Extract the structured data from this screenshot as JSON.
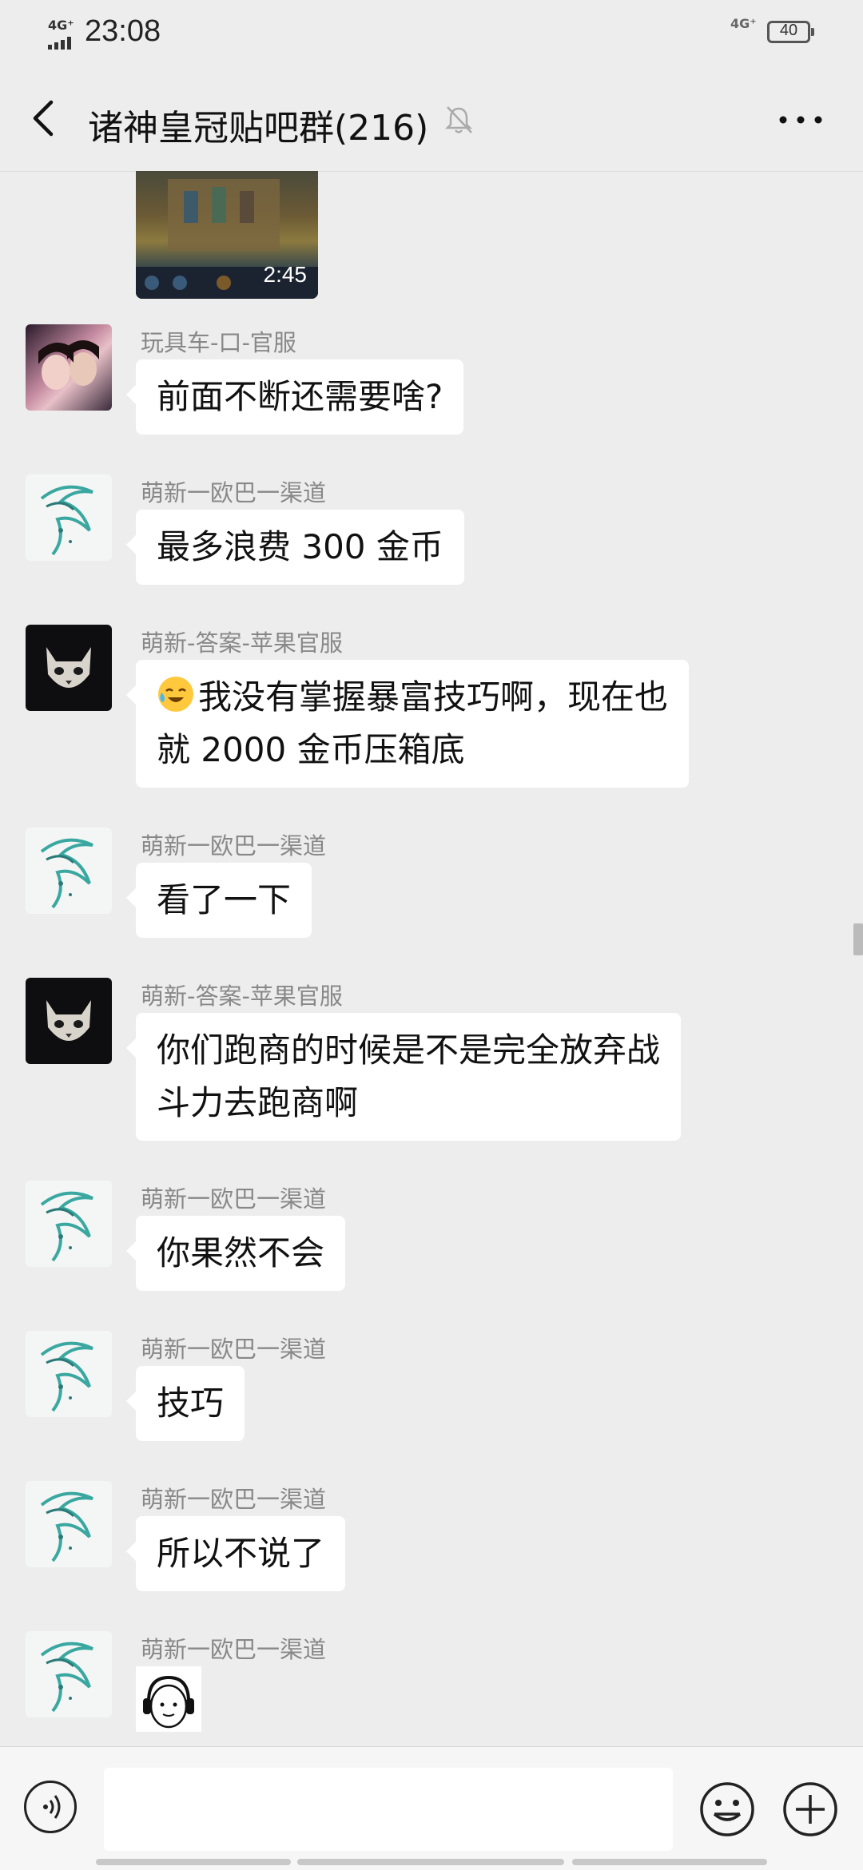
{
  "status_bar": {
    "network_left": "4G⁺",
    "time": "23:08",
    "network_right": "4G⁺",
    "battery": "40"
  },
  "header": {
    "title": "诸神皇冠贴吧群(216)",
    "back_icon": "chevron-left-icon",
    "mute_icon": "bell-muted-icon",
    "more_icon": "more-dots-icon"
  },
  "video_message": {
    "duration": "2:45"
  },
  "messages": [
    {
      "sender": "玩具车-口-官服",
      "text": "前面不断还需要啥?"
    },
    {
      "sender": "萌新一欧巴一渠道",
      "text": "最多浪费 300 金币"
    },
    {
      "sender": "萌新-答案-苹果官服",
      "lines": [
        "我没有掌握暴富技巧啊，现在也",
        "就 2000 金币压箱底"
      ],
      "emoji": "crying-laughing-face"
    },
    {
      "sender": "萌新一欧巴一渠道",
      "text": "看了一下"
    },
    {
      "sender": "萌新-答案-苹果官服",
      "lines": [
        "你们跑商的时候是不是完全放弃战",
        "斗力去跑商啊"
      ]
    },
    {
      "sender": "萌新一欧巴一渠道",
      "text": "你果然不会"
    },
    {
      "sender": "萌新一欧巴一渠道",
      "text": "技巧"
    },
    {
      "sender": "萌新一欧巴一渠道",
      "text": "所以不说了"
    },
    {
      "sender": "萌新一欧巴一渠道",
      "sticker": "headphones-cartoon-sticker"
    }
  ],
  "composer": {
    "input_value": "",
    "voice_icon": "voice-icon",
    "emoji_icon": "smiley-icon",
    "plus_icon": "plus-icon"
  }
}
